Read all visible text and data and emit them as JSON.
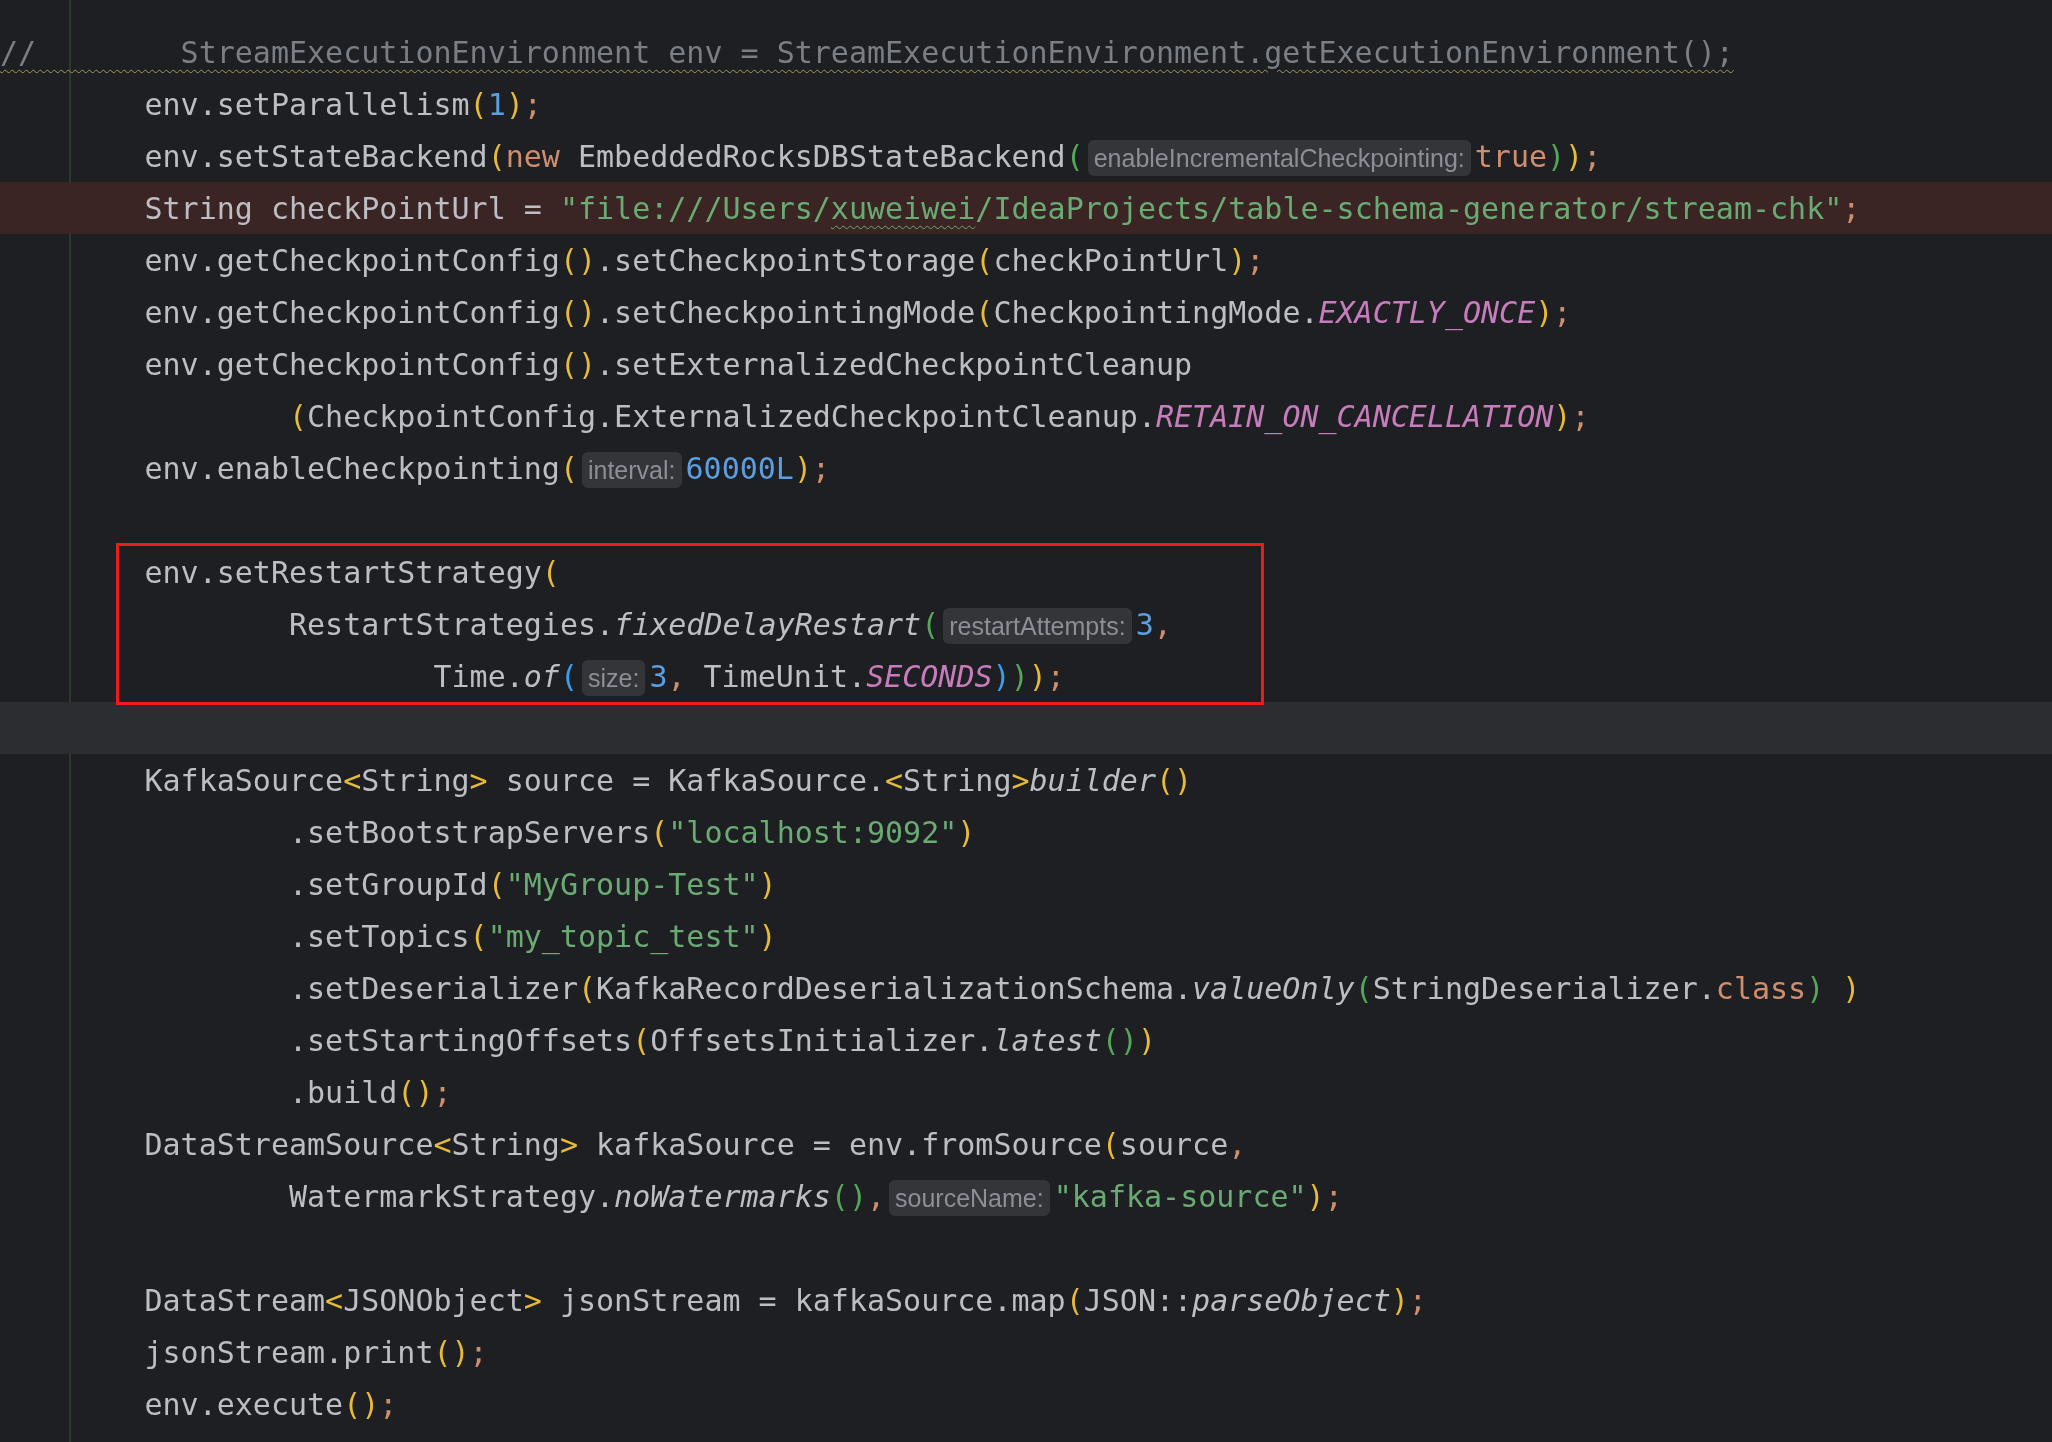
{
  "editor": {
    "blocks": [
      {
        "kind": "plain",
        "lines": [
          {
            "error": false,
            "current": false,
            "tokens": [
              {
                "kind": "comment",
                "text": "//        StreamExecutionEnvironment env = StreamExecutionEnvironment.getExecutionEnvironment();"
              }
            ]
          },
          {
            "error": false,
            "current": false,
            "tokens": [
              {
                "kind": "plain",
                "text": "        env.setParallelism"
              },
              {
                "kind": "paren1",
                "text": "("
              },
              {
                "kind": "number",
                "text": "1"
              },
              {
                "kind": "paren1",
                "text": ")"
              },
              {
                "kind": "punct",
                "text": ";"
              }
            ]
          },
          {
            "error": false,
            "current": false,
            "tokens": [
              {
                "kind": "plain",
                "text": "        env.setStateBackend"
              },
              {
                "kind": "paren1",
                "text": "("
              },
              {
                "kind": "keyword",
                "text": "new"
              },
              {
                "kind": "plain",
                "text": " EmbeddedRocksDBStateBackend"
              },
              {
                "kind": "paren2",
                "text": "("
              },
              {
                "kind": "hint",
                "text": "enableIncrementalCheckpointing:"
              },
              {
                "kind": "keyword",
                "text": "true"
              },
              {
                "kind": "paren2",
                "text": ")"
              },
              {
                "kind": "paren1",
                "text": ")"
              },
              {
                "kind": "punct",
                "text": ";"
              }
            ]
          },
          {
            "error": true,
            "current": false,
            "tokens": [
              {
                "kind": "plain",
                "text": "        String checkPointUrl = "
              },
              {
                "kind": "string",
                "text": "\"file:///Users/"
              },
              {
                "kind": "typo",
                "text": "xuweiwei"
              },
              {
                "kind": "string",
                "text": "/IdeaProjects/table-schema-generator/stream-chk\""
              },
              {
                "kind": "punct",
                "text": ";"
              }
            ]
          },
          {
            "error": false,
            "current": false,
            "tokens": [
              {
                "kind": "plain",
                "text": "        env.getCheckpointConfig"
              },
              {
                "kind": "paren1",
                "text": "()"
              },
              {
                "kind": "plain",
                "text": ".setCheckpointStorage"
              },
              {
                "kind": "paren1",
                "text": "("
              },
              {
                "kind": "plain",
                "text": "checkPointUrl"
              },
              {
                "kind": "paren1",
                "text": ")"
              },
              {
                "kind": "punct",
                "text": ";"
              }
            ]
          },
          {
            "error": false,
            "current": false,
            "tokens": [
              {
                "kind": "plain",
                "text": "        env.getCheckpointConfig"
              },
              {
                "kind": "paren1",
                "text": "()"
              },
              {
                "kind": "plain",
                "text": ".setCheckpointingMode"
              },
              {
                "kind": "paren1",
                "text": "("
              },
              {
                "kind": "plain",
                "text": "CheckpointingMode."
              },
              {
                "kind": "constant",
                "text": "EXACTLY_ONCE"
              },
              {
                "kind": "paren1",
                "text": ")"
              },
              {
                "kind": "punct",
                "text": ";"
              }
            ]
          },
          {
            "error": false,
            "current": false,
            "tokens": [
              {
                "kind": "plain",
                "text": "        env.getCheckpointConfig"
              },
              {
                "kind": "paren1",
                "text": "()"
              },
              {
                "kind": "plain",
                "text": ".setExternalizedCheckpointCleanup"
              }
            ]
          },
          {
            "error": false,
            "current": false,
            "tokens": [
              {
                "kind": "paren1",
                "text": "                ("
              },
              {
                "kind": "plain",
                "text": "CheckpointConfig.ExternalizedCheckpointCleanup."
              },
              {
                "kind": "constant",
                "text": "RETAIN_ON_CANCELLATION"
              },
              {
                "kind": "paren1",
                "text": ")"
              },
              {
                "kind": "punct",
                "text": ";"
              }
            ]
          },
          {
            "error": false,
            "current": false,
            "tokens": [
              {
                "kind": "plain",
                "text": "        env.enableCheckpointing"
              },
              {
                "kind": "paren1",
                "text": "("
              },
              {
                "kind": "hint",
                "text": "interval:"
              },
              {
                "kind": "number",
                "text": "60000L"
              },
              {
                "kind": "paren1",
                "text": ")"
              },
              {
                "kind": "punct",
                "text": ";"
              }
            ]
          },
          {
            "error": false,
            "current": false
          }
        ]
      },
      {
        "kind": "boxed",
        "lines": [
          {
            "error": false,
            "current": false,
            "tokens": [
              {
                "kind": "plain",
                "text": "        env.setRestartStrategy"
              },
              {
                "kind": "paren1",
                "text": "("
              }
            ]
          },
          {
            "error": false,
            "current": false,
            "tokens": [
              {
                "kind": "plain",
                "text": "                RestartStrategies."
              },
              {
                "kind": "method",
                "text": "fixedDelayRestart"
              },
              {
                "kind": "paren2",
                "text": "("
              },
              {
                "kind": "hint",
                "text": "restartAttempts:"
              },
              {
                "kind": "number",
                "text": "3"
              },
              {
                "kind": "punct",
                "text": ","
              }
            ]
          },
          {
            "error": false,
            "current": false,
            "tokens": [
              {
                "kind": "plain",
                "text": "                        Time."
              },
              {
                "kind": "method",
                "text": "of"
              },
              {
                "kind": "paren3",
                "text": "("
              },
              {
                "kind": "hint",
                "text": "size:"
              },
              {
                "kind": "number",
                "text": "3"
              },
              {
                "kind": "punct",
                "text": ","
              },
              {
                "kind": "plain",
                "text": " TimeUnit."
              },
              {
                "kind": "constant",
                "text": "SECONDS"
              },
              {
                "kind": "paren3",
                "text": ")"
              },
              {
                "kind": "paren2",
                "text": ")"
              },
              {
                "kind": "paren1",
                "text": ")"
              },
              {
                "kind": "punct",
                "text": ";"
              }
            ]
          }
        ]
      },
      {
        "kind": "plain",
        "lines": [
          {
            "error": false,
            "current": true
          },
          {
            "error": false,
            "current": false,
            "tokens": [
              {
                "kind": "plain",
                "text": "        KafkaSource"
              },
              {
                "kind": "paren1",
                "text": "<"
              },
              {
                "kind": "plain",
                "text": "String"
              },
              {
                "kind": "paren1",
                "text": ">"
              },
              {
                "kind": "plain",
                "text": " source = KafkaSource."
              },
              {
                "kind": "paren1",
                "text": "<"
              },
              {
                "kind": "plain",
                "text": "String"
              },
              {
                "kind": "paren1",
                "text": ">"
              },
              {
                "kind": "method",
                "text": "builder"
              },
              {
                "kind": "paren1",
                "text": "()"
              }
            ]
          },
          {
            "error": false,
            "current": false,
            "tokens": [
              {
                "kind": "plain",
                "text": "                .setBootstrapServers"
              },
              {
                "kind": "paren1",
                "text": "("
              },
              {
                "kind": "string",
                "text": "\"localhost:9092\""
              },
              {
                "kind": "paren1",
                "text": ")"
              }
            ]
          },
          {
            "error": false,
            "current": false,
            "tokens": [
              {
                "kind": "plain",
                "text": "                .setGroupId"
              },
              {
                "kind": "paren1",
                "text": "("
              },
              {
                "kind": "string",
                "text": "\"MyGroup-Test\""
              },
              {
                "kind": "paren1",
                "text": ")"
              }
            ]
          },
          {
            "error": false,
            "current": false,
            "tokens": [
              {
                "kind": "plain",
                "text": "                .setTopics"
              },
              {
                "kind": "paren1",
                "text": "("
              },
              {
                "kind": "string",
                "text": "\"my_topic_test\""
              },
              {
                "kind": "paren1",
                "text": ")"
              }
            ]
          },
          {
            "error": false,
            "current": false,
            "tokens": [
              {
                "kind": "plain",
                "text": "                .setDeserializer"
              },
              {
                "kind": "paren1",
                "text": "("
              },
              {
                "kind": "plain",
                "text": "KafkaRecordDeserializationSchema."
              },
              {
                "kind": "method",
                "text": "valueOnly"
              },
              {
                "kind": "paren2",
                "text": "("
              },
              {
                "kind": "plain",
                "text": "StringDeserializer."
              },
              {
                "kind": "keyword",
                "text": "class"
              },
              {
                "kind": "paren2",
                "text": ")"
              },
              {
                "kind": "paren1",
                "text": " )"
              }
            ]
          },
          {
            "error": false,
            "current": false,
            "tokens": [
              {
                "kind": "plain",
                "text": "                .setStartingOffsets"
              },
              {
                "kind": "paren1",
                "text": "("
              },
              {
                "kind": "plain",
                "text": "OffsetsInitializer."
              },
              {
                "kind": "method",
                "text": "latest"
              },
              {
                "kind": "paren2",
                "text": "()"
              },
              {
                "kind": "paren1",
                "text": ")"
              }
            ]
          },
          {
            "error": false,
            "current": false,
            "tokens": [
              {
                "kind": "plain",
                "text": "                .build"
              },
              {
                "kind": "paren1",
                "text": "()"
              },
              {
                "kind": "punct",
                "text": ";"
              }
            ]
          },
          {
            "error": false,
            "current": false,
            "tokens": [
              {
                "kind": "plain",
                "text": "        DataStreamSource"
              },
              {
                "kind": "paren1",
                "text": "<"
              },
              {
                "kind": "plain",
                "text": "String"
              },
              {
                "kind": "paren1",
                "text": ">"
              },
              {
                "kind": "plain",
                "text": " kafkaSource = env.fromSource"
              },
              {
                "kind": "paren1",
                "text": "("
              },
              {
                "kind": "plain",
                "text": "source"
              },
              {
                "kind": "punct",
                "text": ","
              }
            ]
          },
          {
            "error": false,
            "current": false,
            "tokens": [
              {
                "kind": "plain",
                "text": "                WatermarkStrategy."
              },
              {
                "kind": "method",
                "text": "noWatermarks"
              },
              {
                "kind": "paren2",
                "text": "()"
              },
              {
                "kind": "punct",
                "text": ","
              },
              {
                "kind": "hint",
                "text": "sourceName:"
              },
              {
                "kind": "string",
                "text": "\"kafka-source\""
              },
              {
                "kind": "paren1",
                "text": ")"
              },
              {
                "kind": "punct",
                "text": ";"
              }
            ]
          },
          {
            "error": false,
            "current": false
          },
          {
            "error": false,
            "current": false,
            "tokens": [
              {
                "kind": "plain",
                "text": "        DataStream"
              },
              {
                "kind": "paren1",
                "text": "<"
              },
              {
                "kind": "plain",
                "text": "JSONObject"
              },
              {
                "kind": "paren1",
                "text": ">"
              },
              {
                "kind": "plain",
                "text": " jsonStream = kafkaSource.map"
              },
              {
                "kind": "paren1",
                "text": "("
              },
              {
                "kind": "plain",
                "text": "JSON::"
              },
              {
                "kind": "method",
                "text": "parseObject"
              },
              {
                "kind": "paren1",
                "text": ")"
              },
              {
                "kind": "punct",
                "text": ";"
              }
            ]
          },
          {
            "error": false,
            "current": false,
            "tokens": [
              {
                "kind": "plain",
                "text": "        jsonStream.print"
              },
              {
                "kind": "paren1",
                "text": "()"
              },
              {
                "kind": "punct",
                "text": ";"
              }
            ]
          },
          {
            "error": false,
            "current": false,
            "tokens": [
              {
                "kind": "plain",
                "text": "        env.execute"
              },
              {
                "kind": "paren1",
                "text": "()"
              },
              {
                "kind": "punct",
                "text": ";"
              }
            ]
          }
        ]
      }
    ]
  }
}
